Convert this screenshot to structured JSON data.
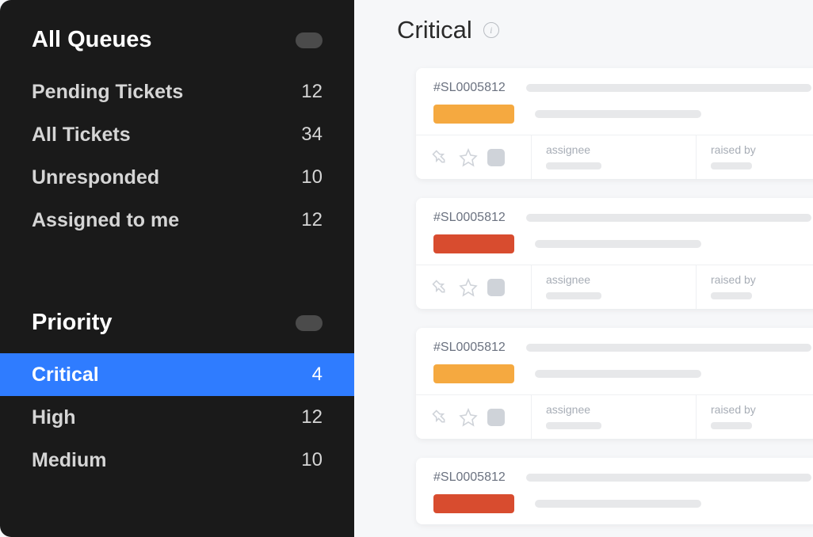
{
  "sidebar": {
    "queues": {
      "title": "All Queues",
      "items": [
        {
          "label": "Pending Tickets",
          "count": "12"
        },
        {
          "label": "All Tickets",
          "count": "34"
        },
        {
          "label": "Unresponded",
          "count": "10"
        },
        {
          "label": "Assigned to me",
          "count": "12"
        }
      ]
    },
    "priority": {
      "title": "Priority",
      "items": [
        {
          "label": "Critical",
          "count": "4",
          "selected": true
        },
        {
          "label": "High",
          "count": "12"
        },
        {
          "label": "Medium",
          "count": "10"
        }
      ]
    }
  },
  "main": {
    "title": "Critical",
    "assignee_label": "assignee",
    "raised_by_label": "raised by",
    "tickets": [
      {
        "id": "#SL0005812",
        "chip_color": "orange"
      },
      {
        "id": "#SL0005812",
        "chip_color": "red"
      },
      {
        "id": "#SL0005812",
        "chip_color": "orange"
      },
      {
        "id": "#SL0005812",
        "chip_color": "red"
      }
    ]
  },
  "colors": {
    "sidebar_bg": "#1a1a1a",
    "selected_bg": "#2f7cff",
    "chip_orange": "#f5a940",
    "chip_red": "#d84c2f"
  }
}
